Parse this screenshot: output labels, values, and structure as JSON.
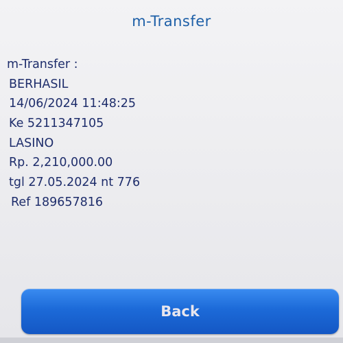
{
  "header": {
    "title": "m-Transfer"
  },
  "receipt": {
    "lines": [
      "m-Transfer :",
      "BERHASIL",
      "14/06/2024 11:48:25",
      "Ke 5211347105",
      "LASINO",
      "Rp. 2,210,000.00",
      "tgl 27.05.2024 nt 776",
      "Ref 189657816"
    ]
  },
  "footer": {
    "back_label": "Back"
  },
  "colors": {
    "title": "#1d5fa7",
    "text": "#1e2d6b",
    "button": "#1c6ad8"
  }
}
